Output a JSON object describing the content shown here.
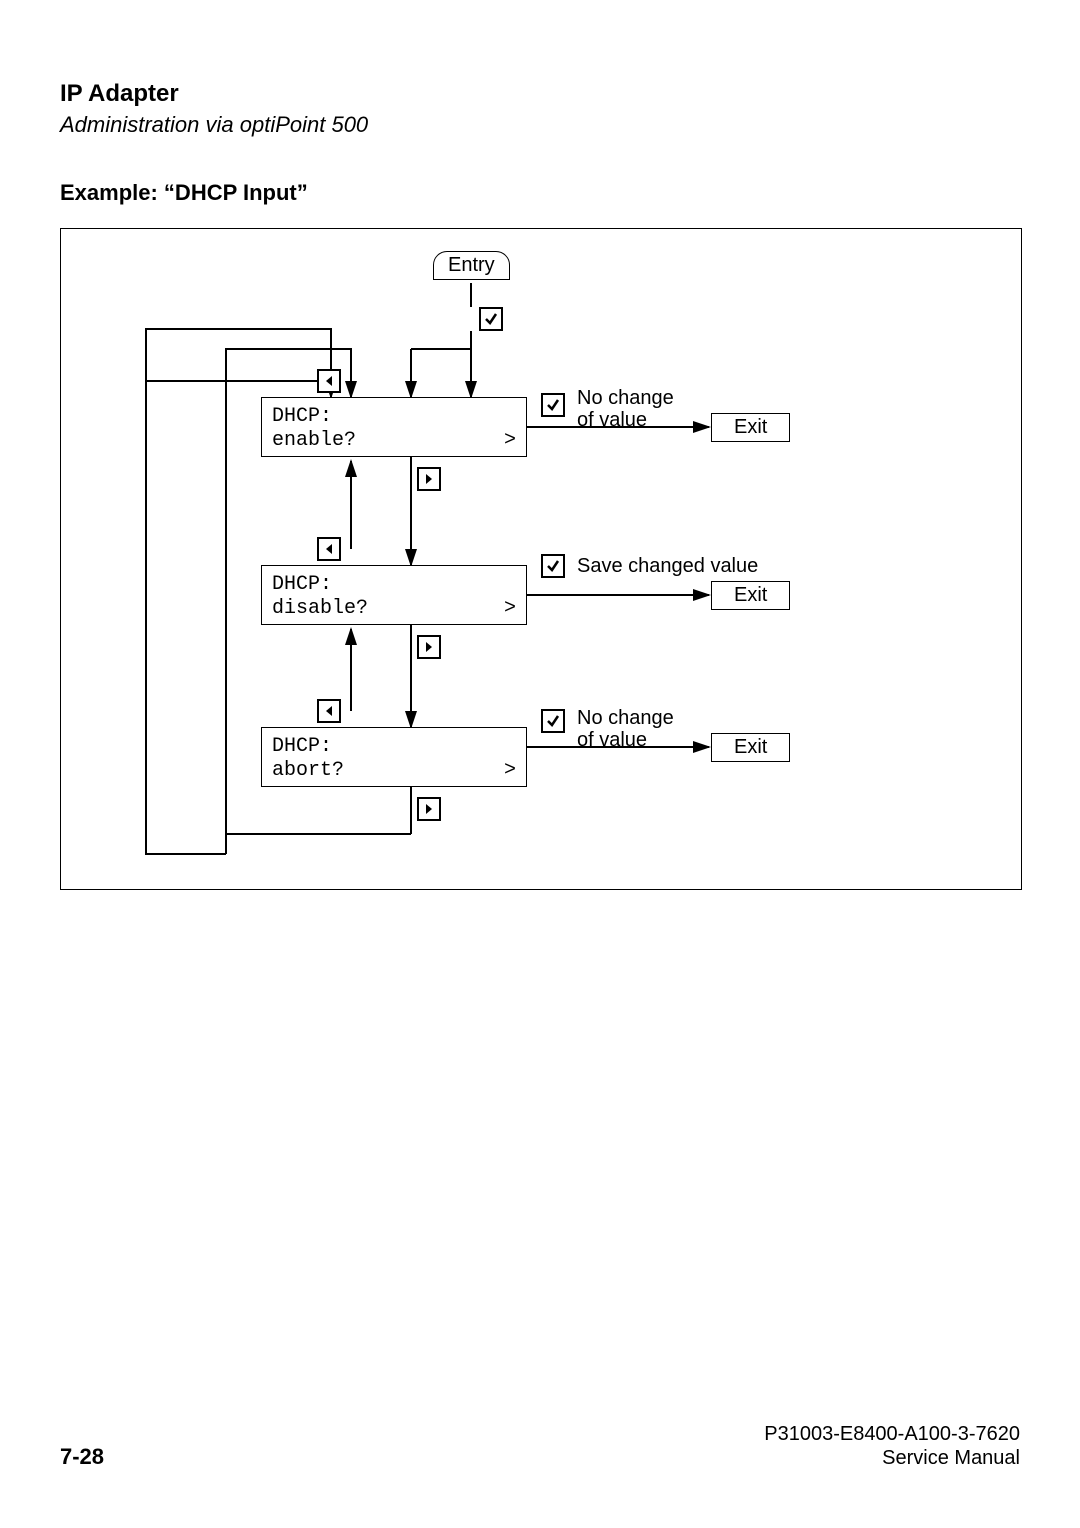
{
  "header": {
    "title": "IP Adapter",
    "subtitle": "Administration via optiPoint 500"
  },
  "example_title": "Example: “DHCP Input”",
  "diagram": {
    "entry_label": "Entry",
    "boxes": {
      "enable": {
        "line1": "DHCP:",
        "line2": "enable?",
        "suffix": ">"
      },
      "disable": {
        "line1": "DHCP:",
        "line2": "disable?",
        "suffix": ">"
      },
      "abort": {
        "line1": "DHCP:",
        "line2": "abort?",
        "suffix": ">"
      }
    },
    "labels": {
      "nochange1_a": "No change",
      "nochange1_b": "of value",
      "save": "Save changed value",
      "nochange2_a": "No change",
      "nochange2_b": "of value"
    },
    "exit_label": "Exit"
  },
  "footer": {
    "page": "7-28",
    "doc_id": "P31003-E8400-A100-3-7620",
    "doc_type": "Service Manual"
  }
}
